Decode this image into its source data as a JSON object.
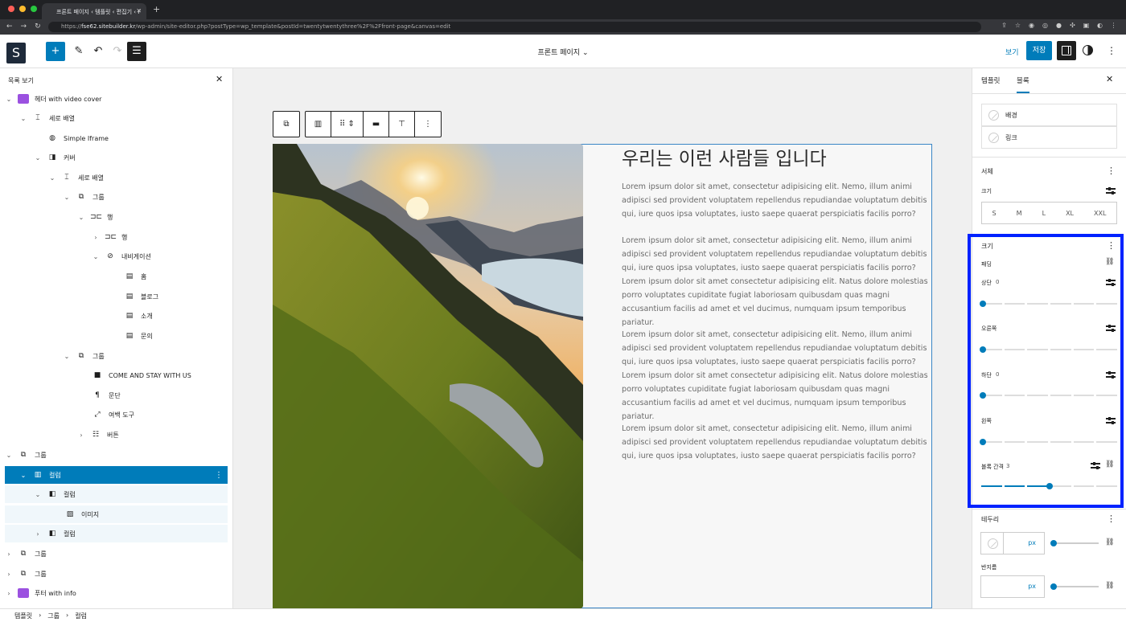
{
  "browser": {
    "tab_title": "프론트 페이지 ‹ 템플릿 ‹ 편집기 ‹ F",
    "url_host": "fse62.sitebuilder.kr",
    "url_prefix": "https://",
    "url_path": "/wp-admin/site-editor.php?postType=wp_template&postId=twentytwentythree%2F%2Ffront-page&canvas=edit"
  },
  "toolbar": {
    "logo": "S",
    "document_title": "프론트 페이지",
    "view_label": "보기",
    "save_label": "저장"
  },
  "list_view": {
    "title": "목록 보기",
    "items": [
      {
        "label": "헤더 with video cover"
      },
      {
        "label": "세로 배열"
      },
      {
        "label": "Simple Iframe"
      },
      {
        "label": "커버"
      },
      {
        "label": "세로 배열"
      },
      {
        "label": "그룹"
      },
      {
        "label": "행"
      },
      {
        "label": "행"
      },
      {
        "label": "내비게이션"
      },
      {
        "label": "홈"
      },
      {
        "label": "블로그"
      },
      {
        "label": "소개"
      },
      {
        "label": "문의"
      },
      {
        "label": "그룹"
      },
      {
        "label": "COME AND STAY WITH US"
      },
      {
        "label": "문단"
      },
      {
        "label": "여백 도구"
      },
      {
        "label": "버튼"
      },
      {
        "label": "그룹"
      },
      {
        "label": "컬럼"
      },
      {
        "label": "컬럼"
      },
      {
        "label": "이미지"
      },
      {
        "label": "컬럼"
      },
      {
        "label": "그룹"
      },
      {
        "label": "그룹"
      },
      {
        "label": "푸터 with info"
      }
    ]
  },
  "breadcrumb": [
    "템플릿",
    "그룹",
    "컬럼"
  ],
  "content": {
    "heading": "우리는 이런 사람들 입니다",
    "paragraphs": [
      "Lorem ipsum dolor sit amet, consectetur adipisicing elit. Nemo, illum animi adipisci sed provident voluptatem repellendus repudiandae voluptatum debitis qui, iure quos ipsa voluptates, iusto saepe quaerat perspiciatis facilis porro?",
      "Lorem ipsum dolor sit amet, consectetur adipisicing elit. Nemo, illum animi adipisci sed provident voluptatem repellendus repudiandae voluptatum debitis qui, iure quos ipsa voluptates, iusto saepe quaerat perspiciatis facilis porro? Lorem ipsum dolor sit amet consectetur adipisicing elit. Natus dolore molestias porro voluptates cupiditate fugiat laboriosam quibusdam quas magni accusantium facilis ad amet et vel ducimus, numquam ipsum temporibus pariatur.",
      "Lorem ipsum dolor sit amet, consectetur adipisicing elit. Nemo, illum animi adipisci sed provident voluptatem repellendus repudiandae voluptatum debitis qui, iure quos ipsa voluptates, iusto saepe quaerat perspiciatis facilis porro? Lorem ipsum dolor sit amet consectetur adipisicing elit. Natus dolore molestias porro voluptates cupiditate fugiat laboriosam quibusdam quas magni accusantium facilis ad amet et vel ducimus, numquam ipsum temporibus pariatur.",
      "Lorem ipsum dolor sit amet, consectetur adipisicing elit. Nemo, illum animi adipisci sed provident voluptatem repellendus repudiandae voluptatum debitis qui, iure quos ipsa voluptates, iusto saepe quaerat perspiciatis facilis porro?"
    ]
  },
  "sidebar": {
    "tabs": [
      "템플릿",
      "블록"
    ],
    "color_items": [
      "배경",
      "링크"
    ],
    "typography": {
      "title": "서체",
      "size_label": "크기",
      "sizes": [
        "S",
        "M",
        "L",
        "XL",
        "XXL"
      ]
    },
    "dimensions": {
      "title": "크기",
      "padding_label": "패딩",
      "top_label": "상단",
      "top_value": "0",
      "right_label": "오른쪽",
      "bottom_label": "하단",
      "bottom_value": "0",
      "left_label": "왼쪽",
      "block_spacing_label": "블록 간격",
      "block_spacing_value": "3",
      "padding_top_level": 0,
      "padding_right_level": 0,
      "padding_bottom_level": 0,
      "padding_left_level": 0,
      "block_spacing_level": 3
    },
    "border": {
      "title": "테두리",
      "unit": "px",
      "radius_label": "반지름",
      "radius_unit": "px"
    }
  },
  "colors": {
    "accent": "#007cba",
    "highlight": "#0022ff"
  }
}
